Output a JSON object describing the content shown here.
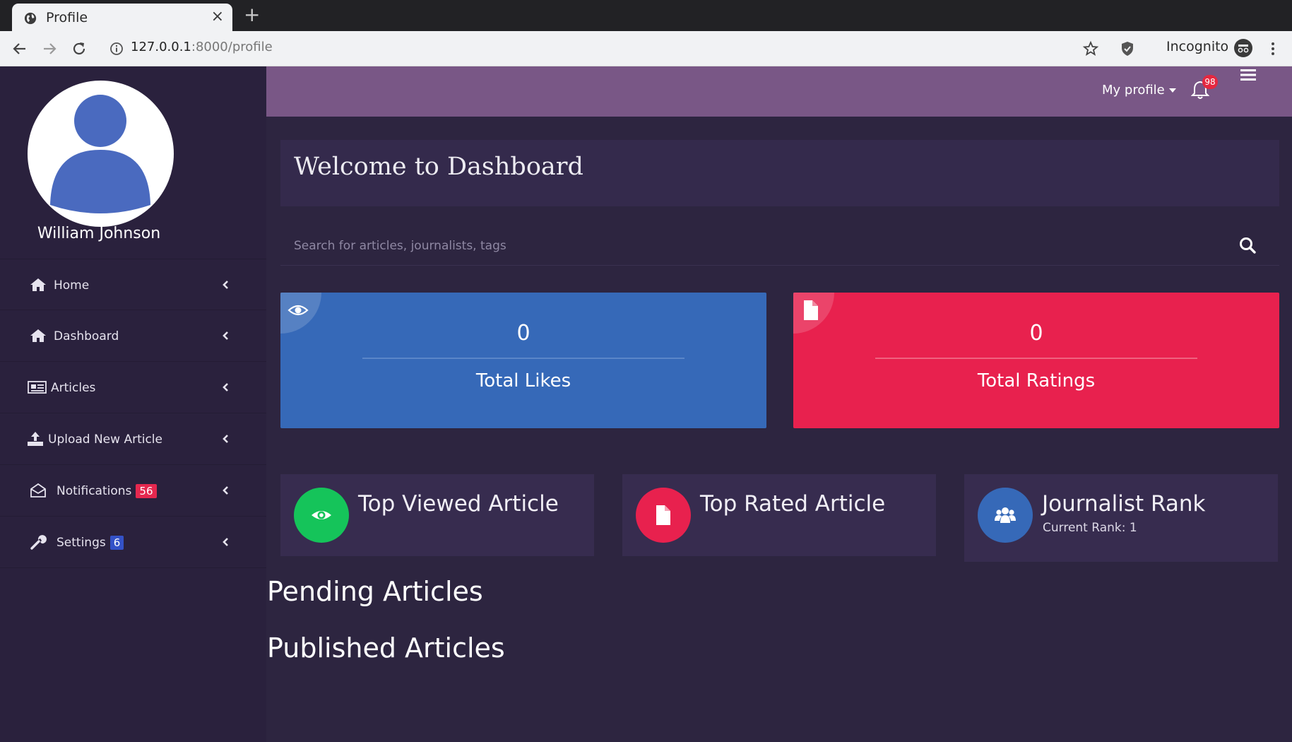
{
  "browser": {
    "tab_title": "Profile",
    "tab_close": "×",
    "new_tab": "+",
    "url_host": "127.0.0.1",
    "url_rest": ":8000/profile",
    "incognito_label": "Incognito"
  },
  "sidebar": {
    "user_name": "William Johnson",
    "items": [
      {
        "label": "Home",
        "icon": "home-icon"
      },
      {
        "label": "Dashboard",
        "icon": "home-icon"
      },
      {
        "label": "Articles",
        "icon": "newspaper-icon"
      },
      {
        "label": "Upload New Article",
        "icon": "upload-icon"
      },
      {
        "label": "Notifications",
        "icon": "envelope-open-icon",
        "badge": "56",
        "badge_color": "#e5284f"
      },
      {
        "label": "Settings",
        "icon": "wrench-icon",
        "badge": "6",
        "badge_color": "#3452c7"
      }
    ]
  },
  "header": {
    "my_profile": "My profile",
    "notification_count": "98"
  },
  "main": {
    "welcome_title": "Welcome to Dashboard",
    "search_placeholder": "Search for articles, journalists, tags",
    "stats": [
      {
        "value": "0",
        "label": "Total Likes",
        "color": "#3669b8",
        "icon": "eye-icon"
      },
      {
        "value": "0",
        "label": "Total Ratings",
        "color": "#e8214e",
        "icon": "file-icon"
      }
    ],
    "info_cards": [
      {
        "title": "Top Viewed Article",
        "subtitle": "",
        "circle_color": "#15c45a",
        "icon": "eye-icon"
      },
      {
        "title": "Top Rated Article",
        "subtitle": "",
        "circle_color": "#e8214e",
        "icon": "file-icon"
      },
      {
        "title": "Journalist Rank",
        "subtitle": "Current Rank: 1",
        "circle_color": "#3669b8",
        "icon": "users-icon"
      }
    ],
    "pending_title": "Pending Articles",
    "published_title": "Published Articles"
  },
  "colors": {
    "sidebar_bg": "#2a213d",
    "main_bg": "#2d2540",
    "header_bg": "#795786",
    "panel_bg": "#342a4c",
    "avatar_blue": "#4a6abf"
  }
}
